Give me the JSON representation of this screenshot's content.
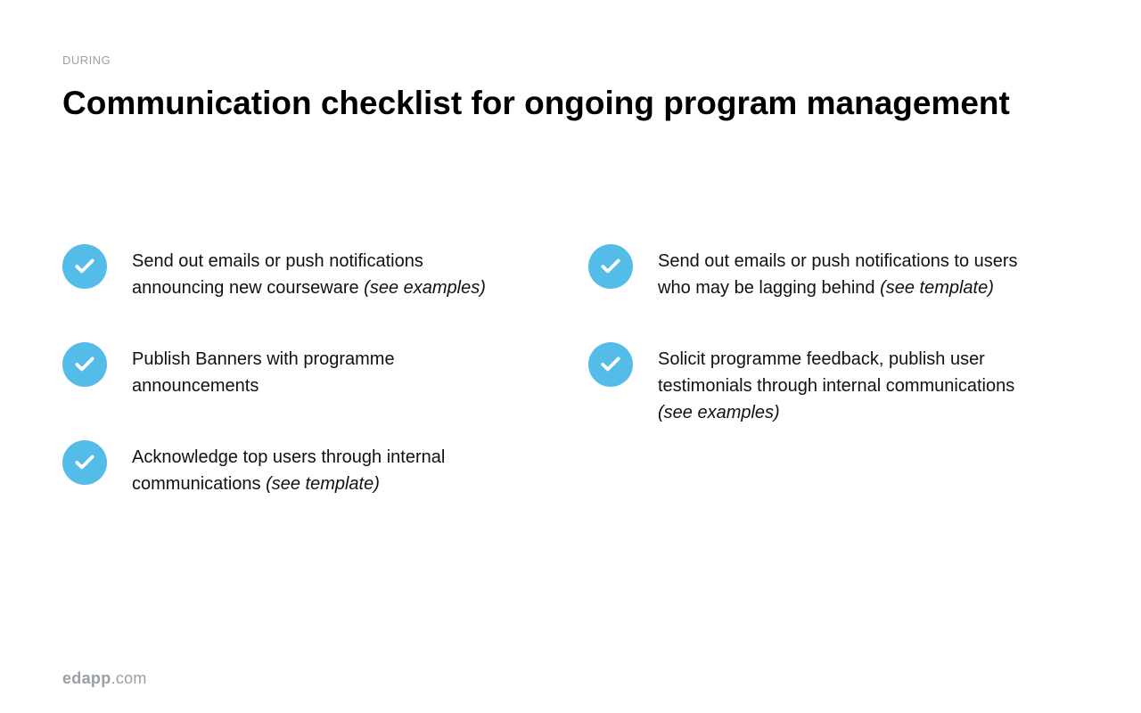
{
  "eyebrow": "DURING",
  "title": "Communication checklist for ongoing program management",
  "columns": {
    "left": [
      {
        "text": "Send out emails or push notifications announcing new courseware ",
        "suffix_italic": "(see examples)"
      },
      {
        "text": "Publish Banners with programme announcements",
        "suffix_italic": ""
      },
      {
        "text": "Acknowledge top users through internal communications ",
        "suffix_italic": "(see template)"
      }
    ],
    "right": [
      {
        "text": "Send out emails or push notifications to users who may be lagging behind ",
        "suffix_italic": "(see template)"
      },
      {
        "text": "Solicit programme feedback, publish user testimonials through internal communications ",
        "suffix_italic": "(see examples)"
      }
    ]
  },
  "footer": {
    "brand_bold": "edapp",
    "brand_rest": ".com"
  },
  "colors": {
    "accent": "#54bce8"
  }
}
